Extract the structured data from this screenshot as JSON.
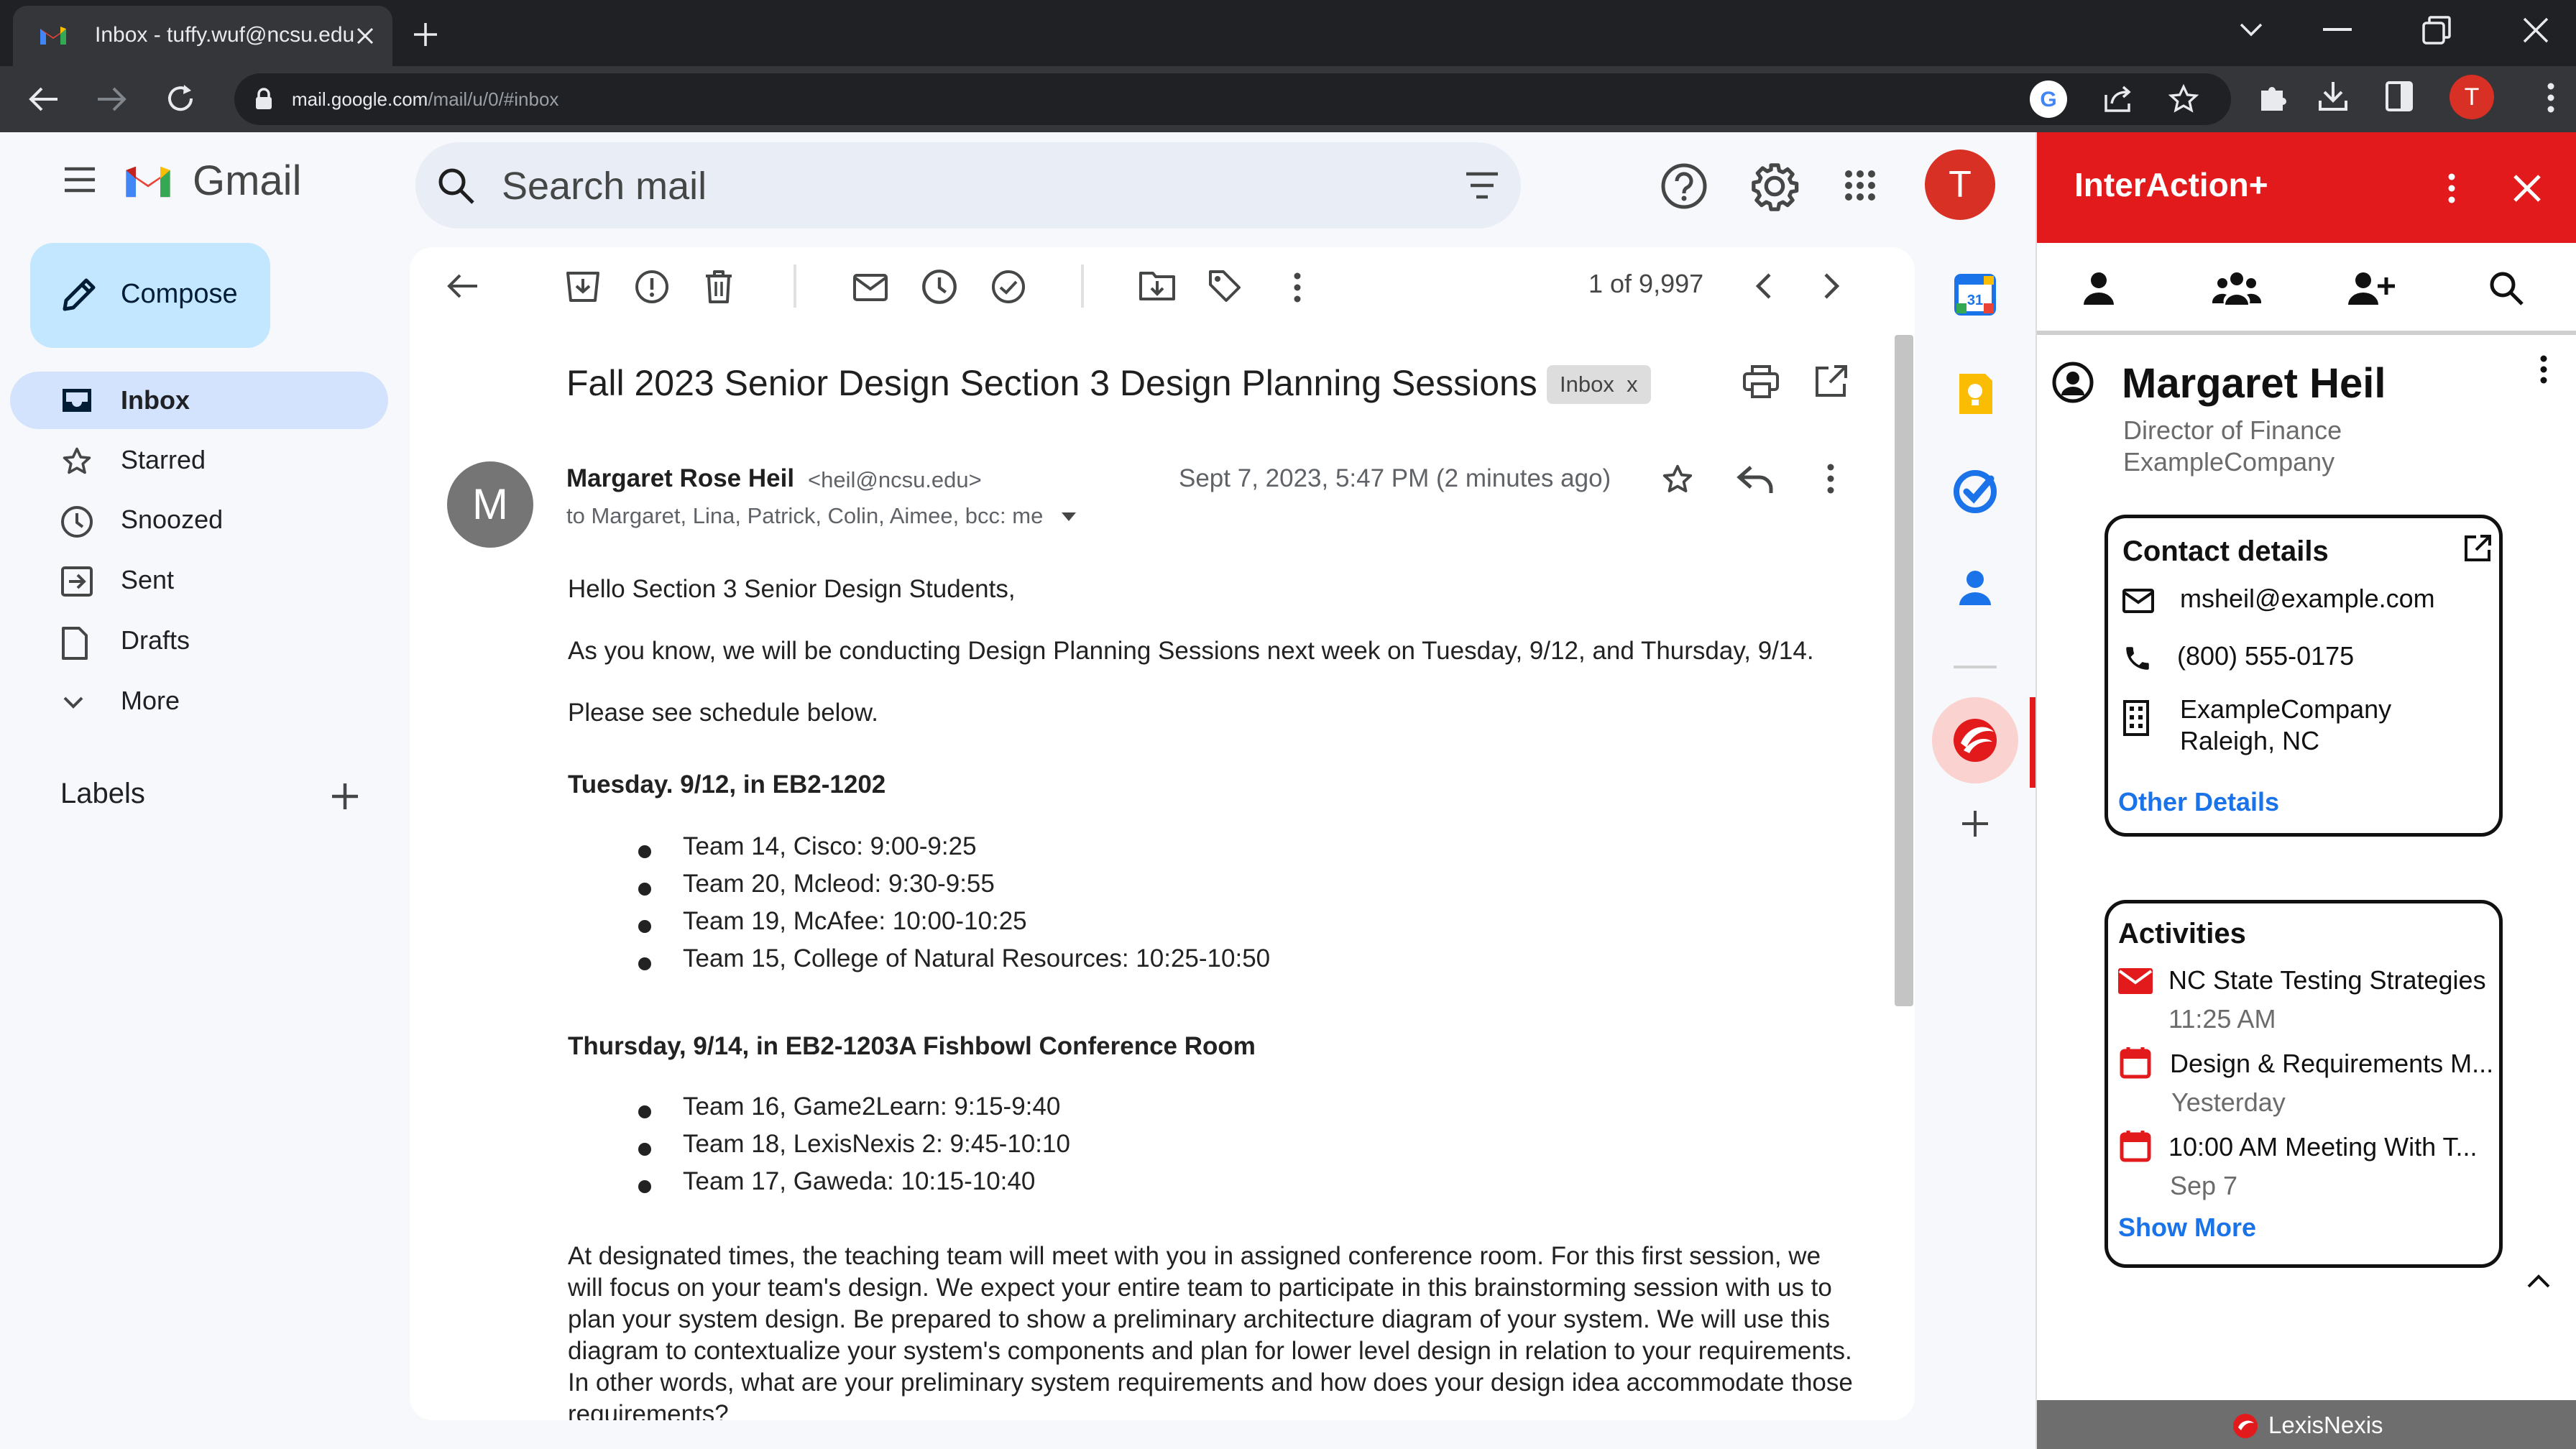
{
  "browser": {
    "tab_title": "Inbox - tuffy.wuf@ncsu.edu",
    "url_host": "mail.google.com",
    "url_path": "/mail/u/0/#inbox",
    "profile_letter": "T"
  },
  "gmail": {
    "brand": "Gmail",
    "search_placeholder": "Search mail",
    "account_letter": "T",
    "compose_label": "Compose",
    "nav": [
      {
        "label": "Inbox",
        "icon": "inbox-icon",
        "active": true
      },
      {
        "label": "Starred",
        "icon": "star-icon"
      },
      {
        "label": "Snoozed",
        "icon": "clock-icon"
      },
      {
        "label": "Sent",
        "icon": "send-icon"
      },
      {
        "label": "Drafts",
        "icon": "draft-icon"
      },
      {
        "label": "More",
        "icon": "chevron-down-icon"
      }
    ],
    "labels_heading": "Labels",
    "pager": "1 of 9,997"
  },
  "email": {
    "subject": "Fall 2023 Senior Design Section 3 Design Planning Sessions",
    "label_chip": "Inbox",
    "label_chip_close": "x",
    "avatar_letter": "M",
    "sender_name": "Margaret Rose Heil",
    "sender_email": "<heil@ncsu.edu>",
    "date": "Sept 7, 2023, 5:47 PM (2 minutes ago)",
    "recipients": "to Margaret, Lina, Patrick, Colin, Aimee, bcc: me",
    "greeting": "Hello Section 3 Senior Design Students,",
    "line1": "As you know, we will be conducting Design Planning Sessions next week on Tuesday, 9/12, and Thursday, 9/14.",
    "line2": "Please see schedule below.",
    "tuesday_heading": "Tuesday. 9/12, in EB2-1202",
    "tuesday_items": [
      "Team 14, Cisco: 9:00-9:25",
      "Team 20, Mcleod: 9:30-9:55",
      "Team 19, McAfee: 10:00-10:25",
      "Team 15, College of Natural Resources: 10:25-10:50"
    ],
    "thursday_heading": "Thursday, 9/14, in EB2-1203A Fishbowl Conference Room",
    "thursday_items": [
      "Team 16, Game2Learn: 9:15-9:40",
      "Team 18, LexisNexis 2: 9:45-10:10",
      "Team 17, Gaweda: 10:15-10:40"
    ],
    "paragraph": "At designated times, the teaching team will meet with you in assigned conference room. For this first session, we will focus on your team's design. We expect your entire team to participate in this brainstorming session with us to plan your system design. Be prepared to show a preliminary architecture diagram of your system. We will use this diagram to contextualize your system's components and plan for lower level design in relation to your requirements. In other words, what are your preliminary system requirements and how does your design idea accommodate those requirements?"
  },
  "side_apps": {
    "calendar_day": "31"
  },
  "interaction": {
    "title": "InterAction+",
    "contact": {
      "name": "Margaret Heil",
      "title": "Director of Finance",
      "company": "ExampleCompany"
    },
    "contact_details": {
      "heading": "Contact details",
      "email": "msheil@example.com",
      "phone": "(800) 555-0175",
      "address_line1": "ExampleCompany",
      "address_line2": "Raleigh, NC",
      "link": "Other Details"
    },
    "activities": {
      "heading": "Activities",
      "items": [
        {
          "title": "NC State Testing Strategies",
          "time": "11:25 AM",
          "type": "email"
        },
        {
          "title": "Design & Requirements M...",
          "time": "Yesterday",
          "type": "calendar"
        },
        {
          "title": "10:00 AM Meeting With T...",
          "time": "Sep 7",
          "type": "calendar"
        }
      ],
      "link": "Show More"
    },
    "footer": "LexisNexis"
  },
  "colors": {
    "gmail_bg": "#f6f8fc",
    "compose_bg": "#c2e7ff",
    "active_nav": "#d3e3fd",
    "interaction_red": "#e31a1c",
    "link_blue": "#1a73e8"
  }
}
